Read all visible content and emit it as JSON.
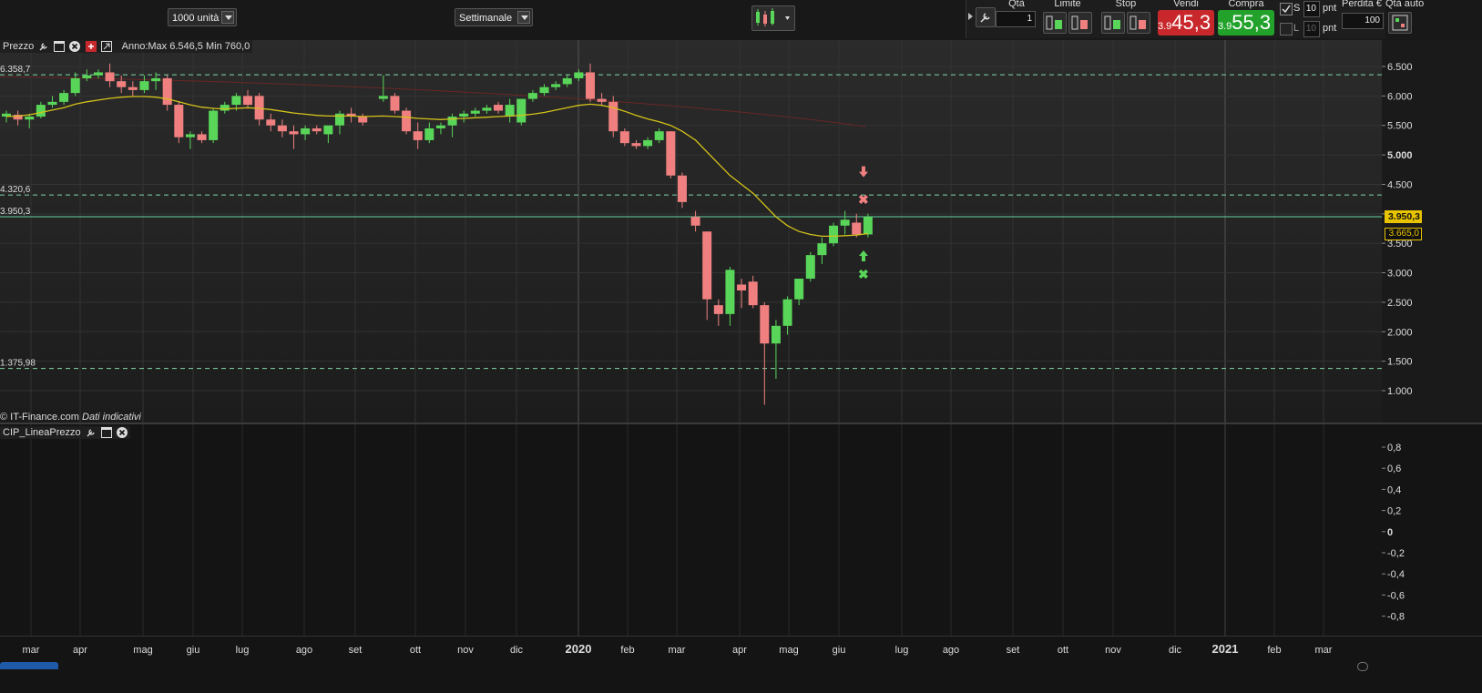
{
  "toolbar": {
    "quantity_select": "1000 unità",
    "period_select": "Settimanale",
    "qty_label": "Qtà",
    "qty_value": "1",
    "limit_label": "Limite",
    "stop_label": "Stop",
    "sell_label": "Vendi",
    "sell_prefix": "3.9",
    "sell_price": "45,3",
    "buy_label": "Compra",
    "buy_prefix": "3.9",
    "buy_price": "55,3",
    "s_label": "S",
    "l_label": "L",
    "s_pnt": "10",
    "l_pnt": "10",
    "pnt_label": "pnt",
    "loss_label": "Perdita €",
    "auto_qty_label": "Qtà auto",
    "loss_value": "100"
  },
  "price_pane": {
    "title": "Prezzo",
    "annotation": "Anno:Max 6.546,5 Min 760,0",
    "copyright": "© IT-Finance.com",
    "indicative": "Dati indicativi",
    "level_labels": [
      "6.358,7",
      "4.320,6",
      "3.950,3",
      "1.375,98"
    ],
    "current_price_tag": "3.950,3",
    "ma_price_tag": "3.665,0"
  },
  "indicator_pane": {
    "title": "CIP_LineaPrezzo"
  },
  "colors": {
    "up": "#59d659",
    "down": "#f08080",
    "ma": "#d4c21a",
    "level_dash": "#7fd9a8",
    "current_line": "#5fd3a0"
  },
  "chart_data": {
    "type": "candlestick",
    "y_ticks": [
      "6.500",
      "6.000",
      "5.500",
      "5.000",
      "4.500",
      "4.000",
      "3.500",
      "3.000",
      "2.500",
      "2.000",
      "1.500",
      "1.000"
    ],
    "ylim": [
      700,
      6800
    ],
    "indicator_ticks": [
      "0,8",
      "0,6",
      "0,4",
      "0,2",
      "0",
      "-0,2",
      "-0,4",
      "-0,6",
      "-0,8"
    ],
    "x_labels": [
      "mar",
      "apr",
      "mag",
      "giu",
      "lug",
      "ago",
      "set",
      "ott",
      "nov",
      "dic",
      "2020",
      "feb",
      "mar",
      "apr",
      "mag",
      "giu",
      "lug",
      "ago",
      "set",
      "ott",
      "nov",
      "dic",
      "2021",
      "feb",
      "mar"
    ],
    "levels": [
      6358.7,
      4320.6,
      3950.3,
      1375.98
    ],
    "ohlc": [
      [
        5650,
        5750,
        5550,
        5700
      ],
      [
        5680,
        5750,
        5500,
        5600
      ],
      [
        5600,
        5700,
        5450,
        5650
      ],
      [
        5650,
        5900,
        5620,
        5850
      ],
      [
        5850,
        6000,
        5800,
        5900
      ],
      [
        5900,
        6100,
        5850,
        6050
      ],
      [
        6050,
        6400,
        6000,
        6300
      ],
      [
        6300,
        6450,
        6250,
        6350
      ],
      [
        6350,
        6450,
        6300,
        6400
      ],
      [
        6400,
        6550,
        6150,
        6250
      ],
      [
        6250,
        6350,
        6050,
        6150
      ],
      [
        6150,
        6250,
        6000,
        6100
      ],
      [
        6100,
        6350,
        6050,
        6250
      ],
      [
        6250,
        6400,
        6100,
        6300
      ],
      [
        6300,
        6350,
        5750,
        5850
      ],
      [
        5850,
        5900,
        5200,
        5300
      ],
      [
        5300,
        5400,
        5100,
        5350
      ],
      [
        5350,
        5400,
        5200,
        5250
      ],
      [
        5250,
        5800,
        5200,
        5750
      ],
      [
        5750,
        5900,
        5700,
        5850
      ],
      [
        5850,
        6050,
        5750,
        6000
      ],
      [
        6000,
        6100,
        5800,
        5850
      ],
      [
        6000,
        6050,
        5500,
        5600
      ],
      [
        5600,
        5700,
        5400,
        5500
      ],
      [
        5500,
        5600,
        5300,
        5400
      ],
      [
        5400,
        5500,
        5100,
        5350
      ],
      [
        5350,
        5500,
        5250,
        5450
      ],
      [
        5450,
        5500,
        5350,
        5400
      ],
      [
        5350,
        5450,
        5200,
        5500
      ],
      [
        5500,
        5750,
        5350,
        5700
      ],
      [
        5700,
        5800,
        5550,
        5650
      ],
      [
        5650,
        5700,
        5500,
        5550
      ],
      [
        5950,
        6350,
        5900,
        6000
      ],
      [
        6000,
        6050,
        5700,
        5750
      ],
      [
        5750,
        5800,
        5350,
        5400
      ],
      [
        5400,
        5550,
        5100,
        5250
      ],
      [
        5250,
        5550,
        5200,
        5450
      ],
      [
        5450,
        5550,
        5350,
        5500
      ],
      [
        5500,
        5700,
        5300,
        5650
      ],
      [
        5650,
        5750,
        5550,
        5700
      ],
      [
        5700,
        5800,
        5650,
        5750
      ],
      [
        5750,
        5850,
        5700,
        5800
      ],
      [
        5850,
        5900,
        5700,
        5750
      ],
      [
        5650,
        5950,
        5550,
        5850
      ],
      [
        5550,
        5850,
        5500,
        5950
      ],
      [
        5950,
        6100,
        5900,
        6050
      ],
      [
        6050,
        6200,
        6000,
        6150
      ],
      [
        6150,
        6250,
        6100,
        6200
      ],
      [
        6200,
        6350,
        6150,
        6300
      ],
      [
        6300,
        6450,
        6250,
        6400
      ],
      [
        6400,
        6550,
        5900,
        5950
      ],
      [
        5950,
        6050,
        5850,
        5900
      ],
      [
        5900,
        6000,
        5300,
        5400
      ],
      [
        5400,
        5450,
        5150,
        5200
      ],
      [
        5200,
        5250,
        5100,
        5150
      ],
      [
        5150,
        5300,
        5100,
        5250
      ],
      [
        5250,
        5450,
        5200,
        5400
      ],
      [
        5400,
        5400,
        4600,
        4650
      ],
      [
        4650,
        4700,
        4100,
        4200
      ],
      [
        3950,
        4050,
        3700,
        3800
      ],
      [
        3700,
        3700,
        2200,
        2550
      ],
      [
        2450,
        2550,
        2100,
        2300
      ],
      [
        2300,
        3100,
        2100,
        3050
      ],
      [
        2800,
        2900,
        2400,
        2700
      ],
      [
        2850,
        2950,
        2400,
        2450
      ],
      [
        2450,
        2500,
        760,
        1800
      ],
      [
        1800,
        2200,
        1200,
        2100
      ],
      [
        2100,
        2600,
        1950,
        2550
      ],
      [
        2550,
        2850,
        2450,
        2900
      ],
      [
        2900,
        3350,
        2850,
        3300
      ],
      [
        3300,
        3600,
        3150,
        3500
      ],
      [
        3500,
        3850,
        3450,
        3800
      ],
      [
        3800,
        4050,
        3650,
        3900
      ],
      [
        3850,
        4000,
        3600,
        3650
      ],
      [
        3650,
        4000,
        3600,
        3950
      ]
    ],
    "ma": [
      5650,
      5660,
      5680,
      5720,
      5760,
      5800,
      5860,
      5900,
      5930,
      5960,
      5980,
      5990,
      5990,
      5980,
      5950,
      5900,
      5850,
      5810,
      5790,
      5780,
      5790,
      5800,
      5790,
      5770,
      5740,
      5710,
      5690,
      5670,
      5660,
      5660,
      5660,
      5650,
      5660,
      5650,
      5640,
      5620,
      5610,
      5600,
      5610,
      5620,
      5630,
      5640,
      5650,
      5660,
      5670,
      5690,
      5720,
      5760,
      5800,
      5840,
      5860,
      5840,
      5800,
      5740,
      5670,
      5610,
      5560,
      5500,
      5400,
      5250,
      5050,
      4850,
      4650,
      4500,
      4350,
      4150,
      3950,
      3800,
      3700,
      3650,
      3620,
      3620,
      3630,
      3640,
      3665
    ]
  }
}
